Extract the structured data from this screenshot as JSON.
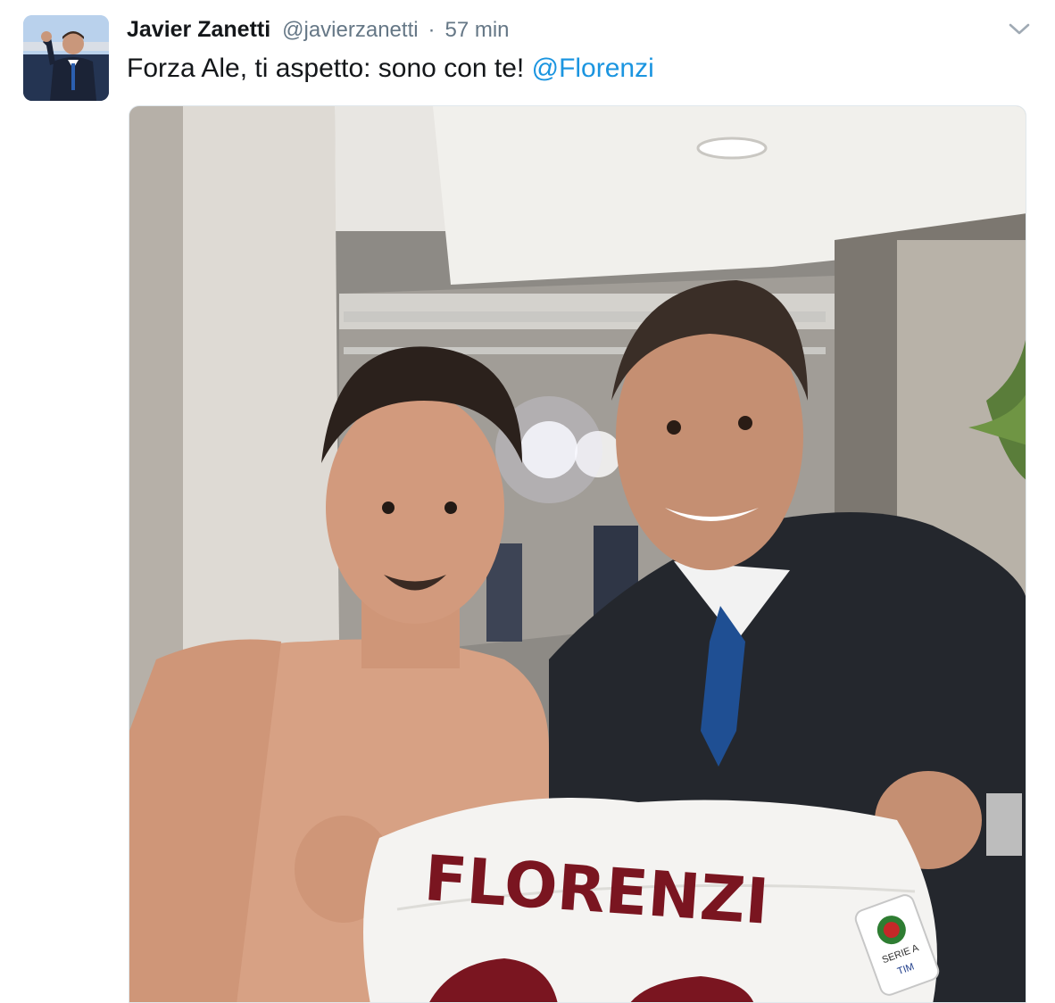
{
  "tweet": {
    "author_name": "Javier Zanetti",
    "author_handle": "@javierzanetti",
    "separator": "·",
    "timestamp": "57 min",
    "text_before_mention": "Forza Ale, ti aspetto: sono con te!",
    "mention": "@Florenzi"
  },
  "photo": {
    "jersey_name": "FLORENZI",
    "patch_text_1": "SERIE A",
    "patch_text_2": "TIM"
  },
  "icons": {
    "caret": "chevron-down-icon"
  },
  "colors": {
    "name": "#14171a",
    "meta": "#657786",
    "mention": "#1b95e0",
    "jersey_lettering": "#7a1520"
  }
}
